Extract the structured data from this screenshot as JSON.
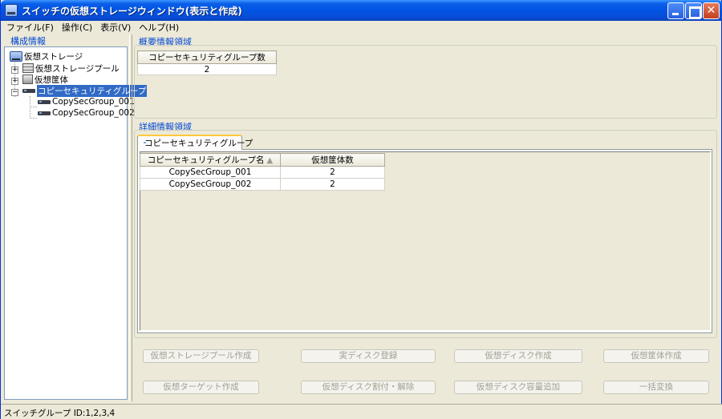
{
  "window": {
    "title": "スイッチの仮想ストレージウィンドウ(表示と作成)"
  },
  "menu": [
    "ファイル(F)",
    "操作(C)",
    "表示(V)",
    "ヘルプ(H)"
  ],
  "left_pane": {
    "label": "構成情報",
    "tree": {
      "root": "仮想ストレージ",
      "children": [
        "仮想ストレージプール",
        "仮想筐体",
        "コピーセキュリティグループ"
      ],
      "groups": [
        "CopySecGroup_001",
        "CopySecGroup_002"
      ],
      "selected": "コピーセキュリティグループ"
    }
  },
  "summary": {
    "label": "概要情報領域",
    "column": "コピーセキュリティグループ数",
    "value": "2"
  },
  "detail": {
    "label": "詳細情報領域",
    "tab": "コピーセキュリティグループ",
    "columns": [
      "コピーセキュリティグループ名",
      "仮想筐体数"
    ],
    "sort_indicator": "▲",
    "rows": [
      [
        "CopySecGroup_001",
        "2"
      ],
      [
        "CopySecGroup_002",
        "2"
      ]
    ]
  },
  "buttons": [
    "仮想ストレージプール作成",
    "実ディスク登録",
    "仮想ディスク作成",
    "仮想筐体作成",
    "仮想ターゲット作成",
    "仮想ディスク割付・解除",
    "仮想ディスク容量追加",
    "一括変換"
  ],
  "status": {
    "text": "スイッチグループ ID:1,2,3,4"
  },
  "colors": {
    "title_bar": "#0054e3",
    "section_label": "#0046d5",
    "selection": "#316ac5",
    "tab_accent": "#ffc83c"
  }
}
